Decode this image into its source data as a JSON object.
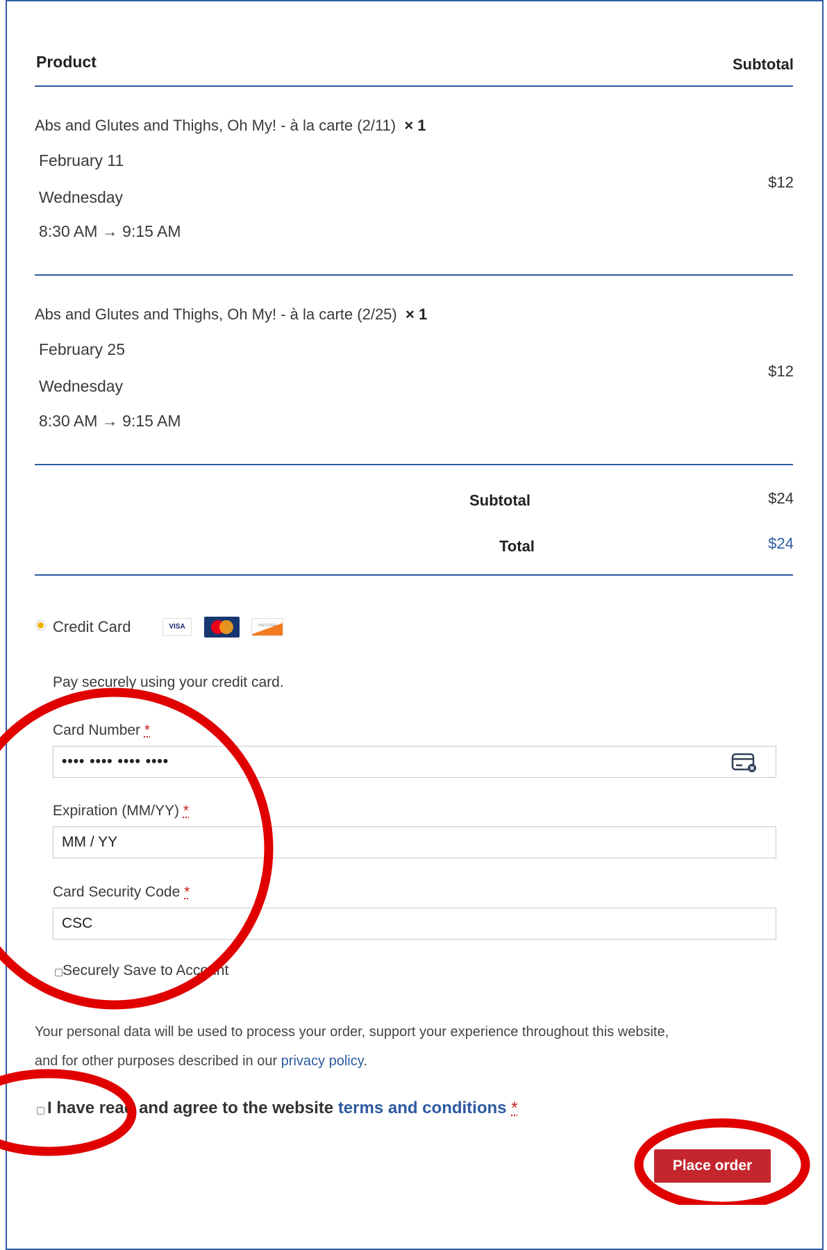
{
  "table": {
    "header_product": "Product",
    "header_subtotal": "Subtotal",
    "items": [
      {
        "name": "Abs and Glutes and Thighs, Oh My! - à la carte (2/11)",
        "qty": "× 1",
        "date": "February 11",
        "weekday": "Wednesday",
        "time": "8:30 AM → 9:15 AM",
        "price": "$12"
      },
      {
        "name": "Abs and Glutes and Thighs, Oh My! - à la carte (2/25)",
        "qty": "× 1",
        "date": "February 25",
        "weekday": "Wednesday",
        "time": "8:30 AM → 9:15 AM",
        "price": "$12"
      }
    ],
    "subtotal_label": "Subtotal",
    "subtotal_value": "$24",
    "total_label": "Total",
    "total_value": "$24"
  },
  "payment": {
    "method_label": "Credit Card",
    "card_icons": [
      "visa-icon",
      "mastercard-icon",
      "discover-icon"
    ],
    "card_brand_text": {
      "visa": "VISA",
      "discover": "DISCOVER"
    },
    "description": "Pay securely using your credit card.",
    "card_number_label": "Card Number",
    "card_number_placeholder": "•••• •••• •••• ••••",
    "expiration_label": "Expiration (MM/YY)",
    "expiration_placeholder": "MM / YY",
    "csc_label": "Card Security Code",
    "csc_placeholder": "CSC",
    "required_mark": "*",
    "save_label": "Securely Save to Account"
  },
  "privacy": {
    "text_line1": "Your personal data will be used to process your order, support your experience throughout this website,",
    "text_line2_prefix": "and for other purposes described in our",
    "link": "privacy policy",
    "text_line2_suffix": "."
  },
  "terms": {
    "prefix": "I have read and agree to the website",
    "link": "terms and conditions",
    "required_mark": "*"
  },
  "place_order_label": "Place order",
  "colors": {
    "accent_blue": "#2d5aa0",
    "button_red": "#c4262e",
    "annotation_red": "#e00000",
    "radio_gold": "#f2b400"
  }
}
